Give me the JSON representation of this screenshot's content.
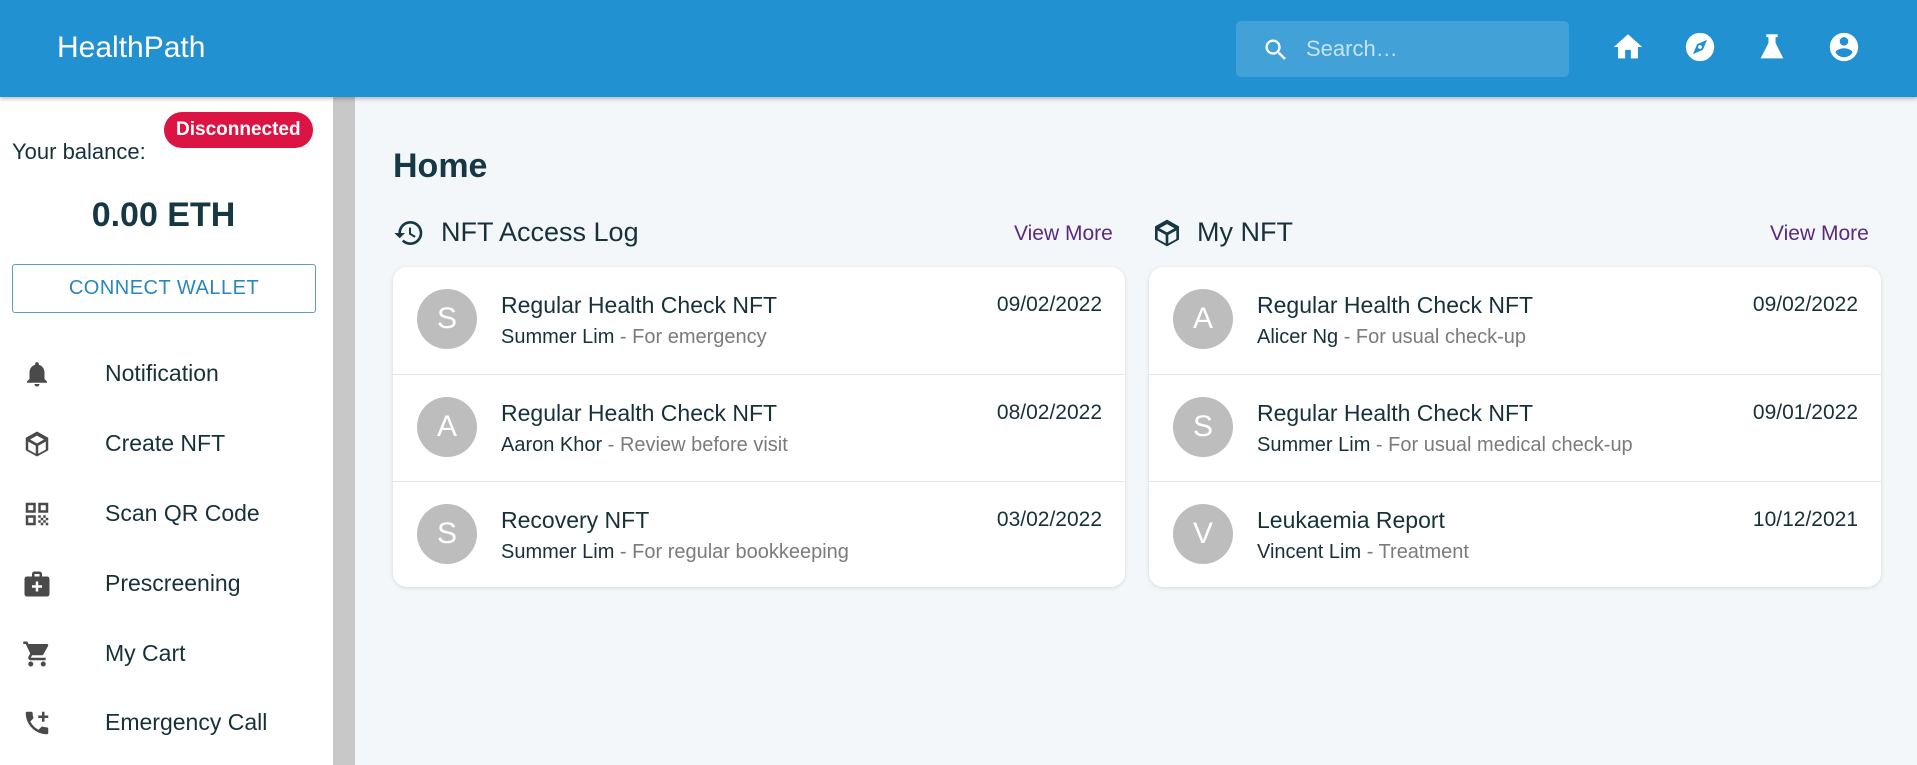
{
  "app": {
    "title": "HealthPath"
  },
  "search": {
    "placeholder": "Search…"
  },
  "nav": [
    "home-icon",
    "compass-icon",
    "flask-icon",
    "account-circle-icon"
  ],
  "sidebar": {
    "status": "Disconnected",
    "balance_label": "Your balance:",
    "balance_value": "0.00 ETH",
    "connect_label": "CONNECT WALLET",
    "items": [
      {
        "label": "Notification",
        "icon": "bell-icon"
      },
      {
        "label": "Create NFT",
        "icon": "cube-icon"
      },
      {
        "label": "Scan QR Code",
        "icon": "qr-code-icon"
      },
      {
        "label": "Prescreening",
        "icon": "medical-bag-icon"
      },
      {
        "label": "My Cart",
        "icon": "cart-icon"
      },
      {
        "label": "Emergency Call",
        "icon": "phone-plus-icon"
      }
    ]
  },
  "main": {
    "title": "Home",
    "access_log": {
      "title": "NFT Access Log",
      "view_more": "View More",
      "items": [
        {
          "initial": "S",
          "title": "Regular Health Check NFT",
          "person": "Summer Lim",
          "reason": " - For emergency",
          "date": "09/02/2022"
        },
        {
          "initial": "A",
          "title": "Regular Health Check NFT",
          "person": "Aaron Khor",
          "reason": " - Review before visit",
          "date": "08/02/2022"
        },
        {
          "initial": "S",
          "title": "Recovery NFT",
          "person": "Summer Lim",
          "reason": " - For regular bookkeeping",
          "date": "03/02/2022"
        }
      ]
    },
    "my_nft": {
      "title": "My NFT",
      "view_more": "View More",
      "items": [
        {
          "initial": "A",
          "title": "Regular Health Check NFT",
          "person": "Alicer Ng",
          "reason": " - For usual check-up",
          "date": "09/02/2022"
        },
        {
          "initial": "S",
          "title": "Regular Health Check NFT",
          "person": "Summer Lim",
          "reason": " - For usual medical check-up",
          "date": "09/01/2022"
        },
        {
          "initial": "V",
          "title": "Leukaemia Report",
          "person": "Vincent Lim",
          "reason": " - Treatment",
          "date": "10/12/2021"
        }
      ]
    }
  },
  "colors": {
    "appbar": "#2191d1",
    "status": "#dc1443",
    "link": "#5a2a80",
    "avatar": "#bdbdbd"
  }
}
